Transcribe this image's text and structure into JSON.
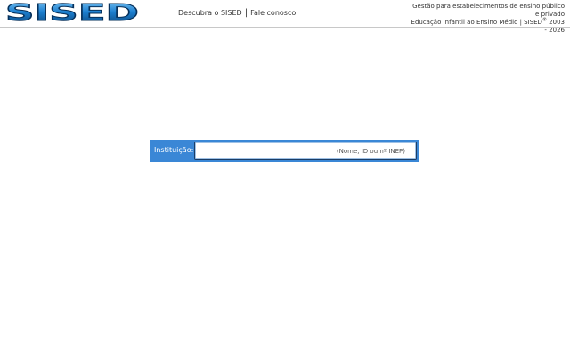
{
  "header": {
    "logo_text": "SISED",
    "nav": {
      "discover_label": "Descubra o SISED",
      "separator": "|",
      "contact_label": "Fale conosco"
    },
    "tagline": {
      "line1": "Gestão para estabelecimentos de ensino público e privado",
      "line2_prefix": "Educação Infantil ao Ensino Médio | SISED",
      "registered": "®",
      "line2_suffix": "2003 - 2026"
    }
  },
  "search": {
    "label": "Instituição:",
    "value": "",
    "placeholder": "(Nome, ID ou nº INEP)"
  },
  "colors": {
    "accent": "#3a87d6",
    "logo_blue": "#1b7fd0",
    "logo_dark": "#0a3f73"
  }
}
